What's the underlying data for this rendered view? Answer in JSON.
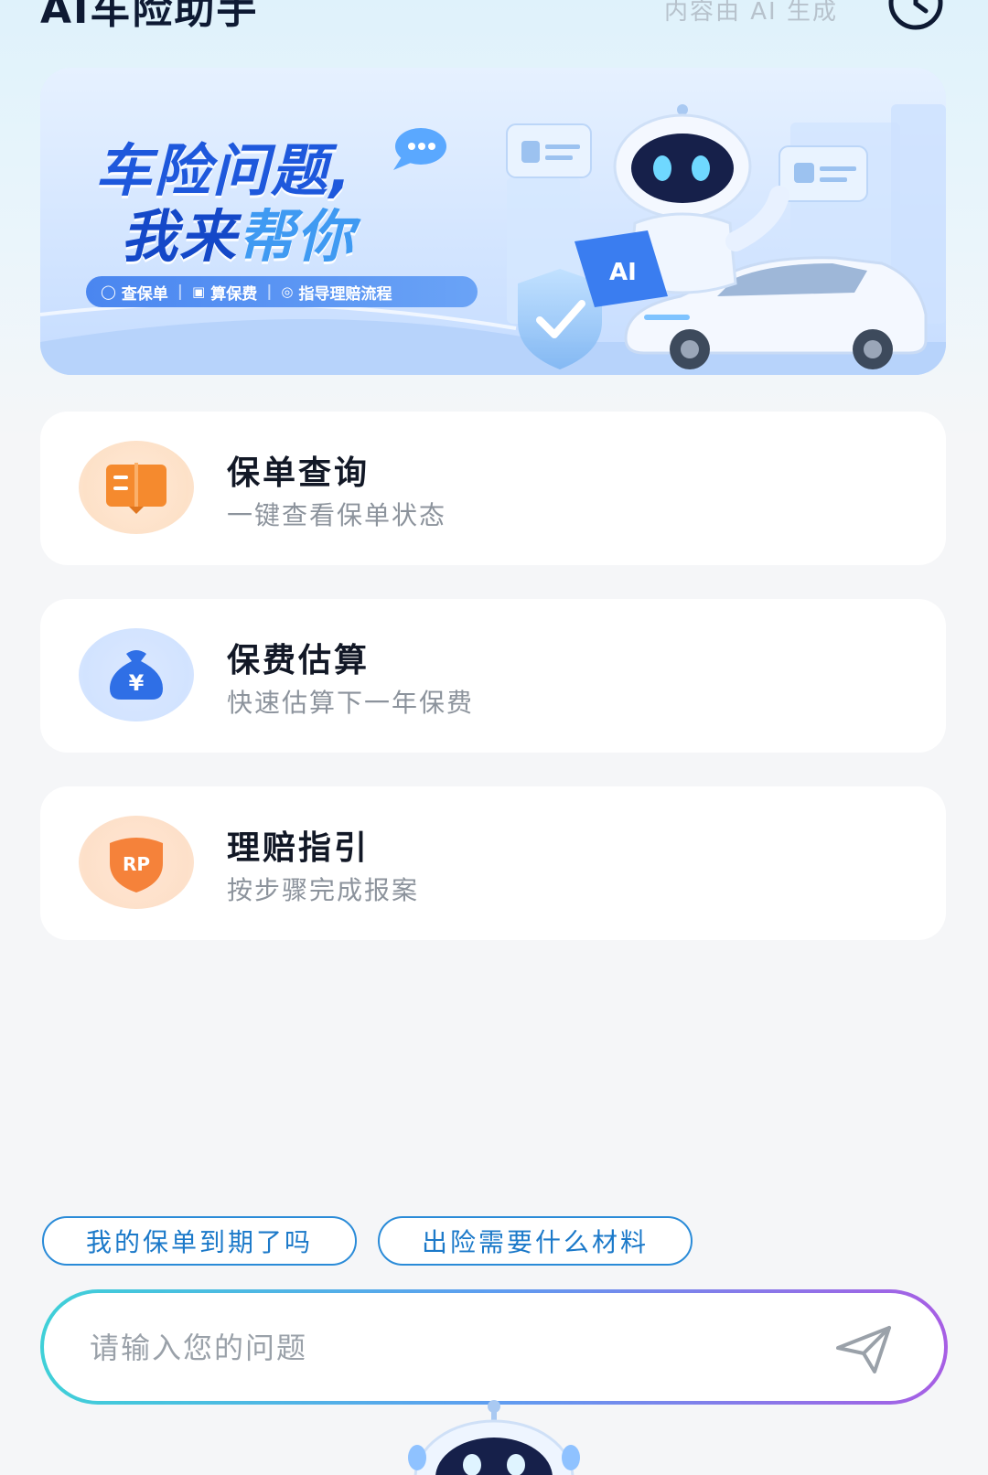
{
  "header": {
    "title": "AI车险助手",
    "ai_note": "内容由 AI 生成",
    "history_icon": "clock-history-icon"
  },
  "banner": {
    "line1": "车险问题,",
    "line2_part1": "我来",
    "line2_part2": "帮你",
    "chips": [
      "查保单",
      "算保费",
      "指导理赔流程"
    ],
    "badge_text": "AI",
    "colors": {
      "headline": "#1e58dc",
      "highlight": "#3f9af2",
      "chip_bar": "#4a86f0"
    }
  },
  "cards": [
    {
      "title": "保单查询",
      "subtitle": "一键查看保单状态",
      "icon": "policy-book-icon",
      "icon_color": "#f58a2e"
    },
    {
      "title": "保费估算",
      "subtitle": "快速估算下一年保费",
      "icon": "money-bag-icon",
      "icon_color": "#2f6fe6"
    },
    {
      "title": "理赔指引",
      "subtitle": "按步骤完成报案",
      "icon": "claim-shield-icon",
      "icon_color": "#f5823a",
      "icon_text": "RP"
    }
  ],
  "quick_questions": [
    "我的保单到期了吗",
    "出险需要什么材料"
  ],
  "input": {
    "placeholder": "请输入您的问题",
    "value": ""
  },
  "send_icon": "send-plane-icon"
}
